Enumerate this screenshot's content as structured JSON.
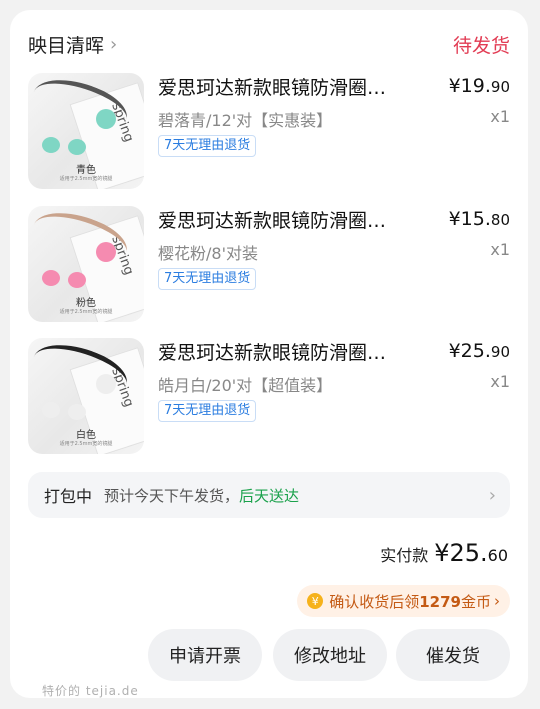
{
  "header": {
    "shop_name": "映目清晖",
    "status": "待发货"
  },
  "items": [
    {
      "title": "爱思珂达新款眼镜防滑圈…",
      "price_main": "¥19.",
      "price_cents": "90",
      "spec": "碧落青/12'对【实惠装】",
      "qty": "x1",
      "tag": "7天无理由退货",
      "thumb_color_label": "青色",
      "thumb_fine": "适用于2.5mm宽的镜腿",
      "thumb_brand": "spring",
      "grip_color": "#7fd6c4",
      "arm_color": "#555555"
    },
    {
      "title": "爱思珂达新款眼镜防滑圈…",
      "price_main": "¥15.",
      "price_cents": "80",
      "spec": "樱花粉/8'对装",
      "qty": "x1",
      "tag": "7天无理由退货",
      "thumb_color_label": "粉色",
      "thumb_fine": "适用于2.5mm宽的镜腿",
      "thumb_brand": "spring",
      "grip_color": "#f58bb0",
      "arm_color": "#c9a38c"
    },
    {
      "title": "爱思珂达新款眼镜防滑圈…",
      "price_main": "¥25.",
      "price_cents": "90",
      "spec": "皓月白/20'对【超值装】",
      "qty": "x1",
      "tag": "7天无理由退货",
      "thumb_color_label": "白色",
      "thumb_fine": "适用于2.5mm宽的镜腿",
      "thumb_brand": "spring",
      "grip_color": "#eeeeee",
      "arm_color": "#222222"
    }
  ],
  "shipping": {
    "label": "打包中",
    "message": "预计今天下午发货，",
    "message_green": "后天送达"
  },
  "total": {
    "label": "实付款",
    "value_main": "¥25.",
    "value_cents": "60"
  },
  "coin_promo": {
    "text_prefix": "确认收货后领",
    "coins": "1279",
    "text_suffix": "金币",
    "icon": "¥"
  },
  "buttons": {
    "invoice": "申请开票",
    "address": "修改地址",
    "urge": "催发货"
  },
  "watermark": "特价的 tejia.de",
  "colors": {
    "status_red": "#e23c54",
    "green": "#1aa14b",
    "tag_blue": "#2b7de0",
    "coin_orange": "#c45a14"
  }
}
